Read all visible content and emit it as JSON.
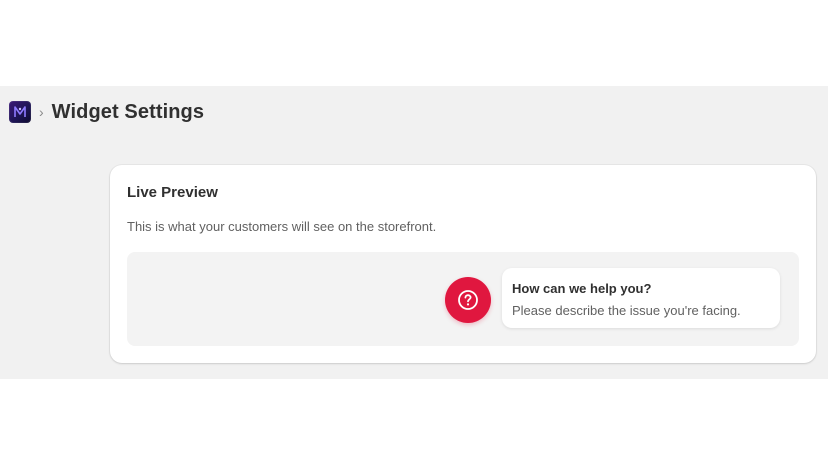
{
  "header": {
    "app_icon": "app-logo-icon",
    "breadcrumb_separator": "›",
    "title": "Widget Settings"
  },
  "preview_card": {
    "title": "Live Preview",
    "description": "This is what your customers will see on the storefront.",
    "launcher": {
      "icon": "question-mark-icon",
      "color": "#e0173f"
    },
    "bubble": {
      "title": "How can we help you?",
      "text": "Please describe the issue you're facing."
    }
  },
  "colors": {
    "page_background": "#f1f1f1",
    "card_background": "#ffffff",
    "preview_background": "#f3f3f3",
    "accent": "#e0173f",
    "text_primary": "#303030",
    "text_secondary": "#616161"
  }
}
